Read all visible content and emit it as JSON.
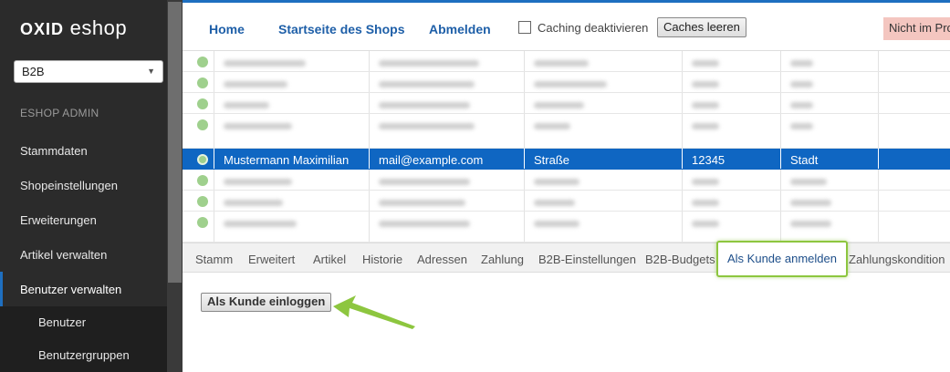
{
  "sidebar": {
    "logo_bold": "OXID",
    "logo_text": "eshop",
    "shop_select": {
      "value": "B2B"
    },
    "caption": "ESHOP ADMIN",
    "items": [
      {
        "label": "Stammdaten"
      },
      {
        "label": "Shopeinstellungen"
      },
      {
        "label": "Erweiterungen"
      },
      {
        "label": "Artikel verwalten"
      },
      {
        "label": "Benutzer verwalten"
      }
    ],
    "subitems": [
      {
        "label": "Benutzer"
      },
      {
        "label": "Benutzergruppen"
      }
    ]
  },
  "topbar": {
    "home": "Home",
    "shop_start": "Startseite des Shops",
    "logout": "Abmelden",
    "caching_label": "Caching deaktivieren",
    "clear_caches": "Caches leeren",
    "warning": "Nicht im Produktivmodus"
  },
  "table": {
    "selected_row": {
      "name": "Mustermann Maximilian",
      "email": "mail@example.com",
      "street": "Straße",
      "zip": "12345",
      "city": "Stadt"
    }
  },
  "tabs": [
    {
      "label": "Stamm"
    },
    {
      "label": "Erweitert"
    },
    {
      "label": "Artikel"
    },
    {
      "label": "Historie"
    },
    {
      "label": "Adressen"
    },
    {
      "label": "Zahlung"
    },
    {
      "label": "B2B-Einstellungen"
    },
    {
      "label": "B2B-Budgets"
    },
    {
      "label": "Als Kunde anmelden"
    },
    {
      "label": "Zahlungskondition"
    }
  ],
  "content": {
    "login_button": "Als Kunde einloggen"
  },
  "colors": {
    "accent": "#1e6fc0",
    "selected_row": "#0f66c2",
    "highlight": "#8dc63f",
    "warning_bg": "#f4c6c0"
  }
}
